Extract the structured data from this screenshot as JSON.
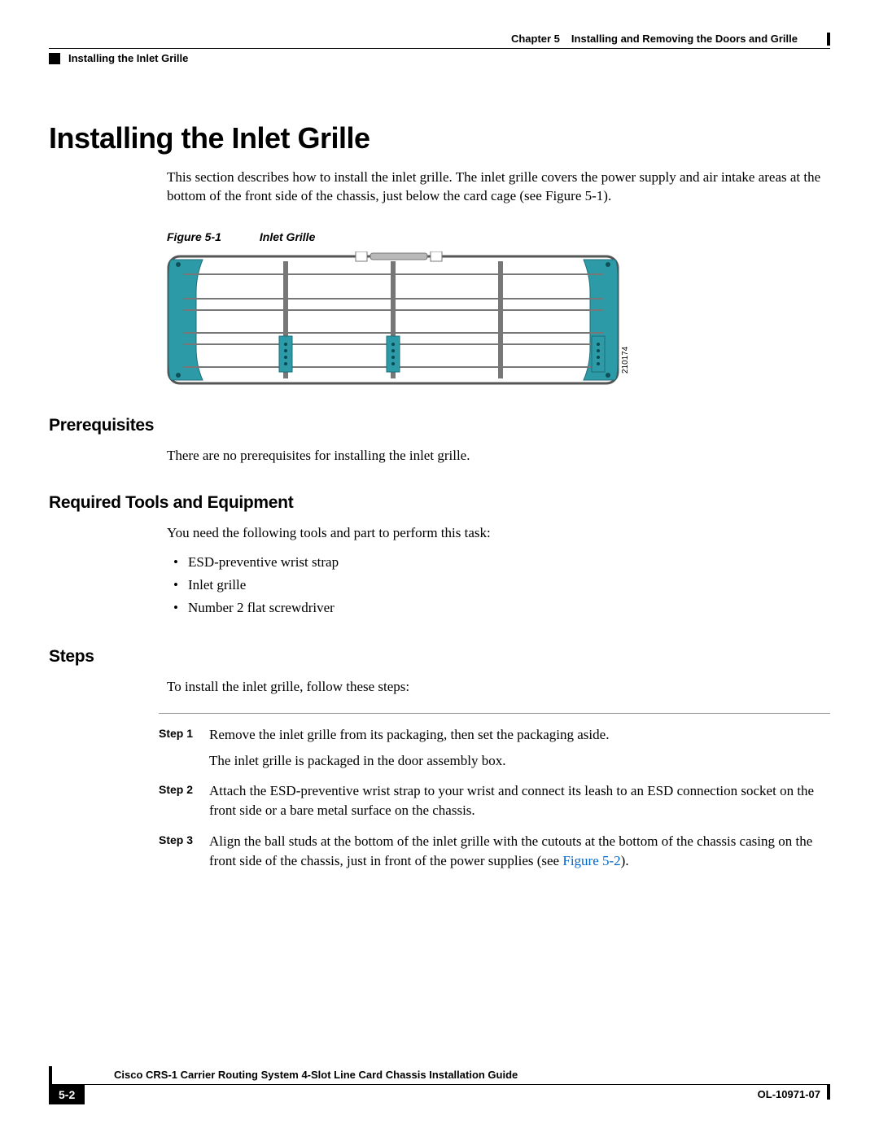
{
  "header": {
    "chapter_label": "Chapter 5",
    "chapter_title": "Installing and Removing the Doors and Grille",
    "section": "Installing the Inlet Grille"
  },
  "title": "Installing the Inlet Grille",
  "intro": "This section describes how to install the inlet grille. The inlet grille covers the power supply and air intake areas at the bottom of the front side of the chassis, just below the card cage (see Figure 5-1).",
  "figure": {
    "label": "Figure 5-1",
    "title": "Inlet Grille",
    "asset_id": "210174"
  },
  "sections": {
    "prereq": {
      "heading": "Prerequisites",
      "text": "There are no prerequisites for installing the inlet grille."
    },
    "tools": {
      "heading": "Required Tools and Equipment",
      "intro": "You need the following tools and part to perform this task:",
      "items": [
        "ESD-preventive wrist strap",
        "Inlet grille",
        "Number 2 flat screwdriver"
      ]
    },
    "steps": {
      "heading": "Steps",
      "intro": "To install the inlet grille, follow these steps:",
      "list": [
        {
          "label": "Step 1",
          "text": "Remove the inlet grille from its packaging, then set the packaging aside.",
          "extra": "The inlet grille is packaged in the door assembly box."
        },
        {
          "label": "Step 2",
          "text": "Attach the ESD-preventive wrist strap to your wrist and connect its leash to an ESD connection socket on the front side or a bare metal surface on the chassis."
        },
        {
          "label": "Step 3",
          "text": "Align the ball studs at the bottom of the inlet grille with the cutouts at the bottom of the chassis casing on the front side of the chassis, just in front of the power supplies (see ",
          "link": "Figure 5-2",
          "after_link": ")."
        }
      ]
    }
  },
  "footer": {
    "guide_title": "Cisco CRS-1 Carrier Routing System 4-Slot Line Card Chassis Installation Guide",
    "page": "5-2",
    "doc_number": "OL-10971-07"
  }
}
